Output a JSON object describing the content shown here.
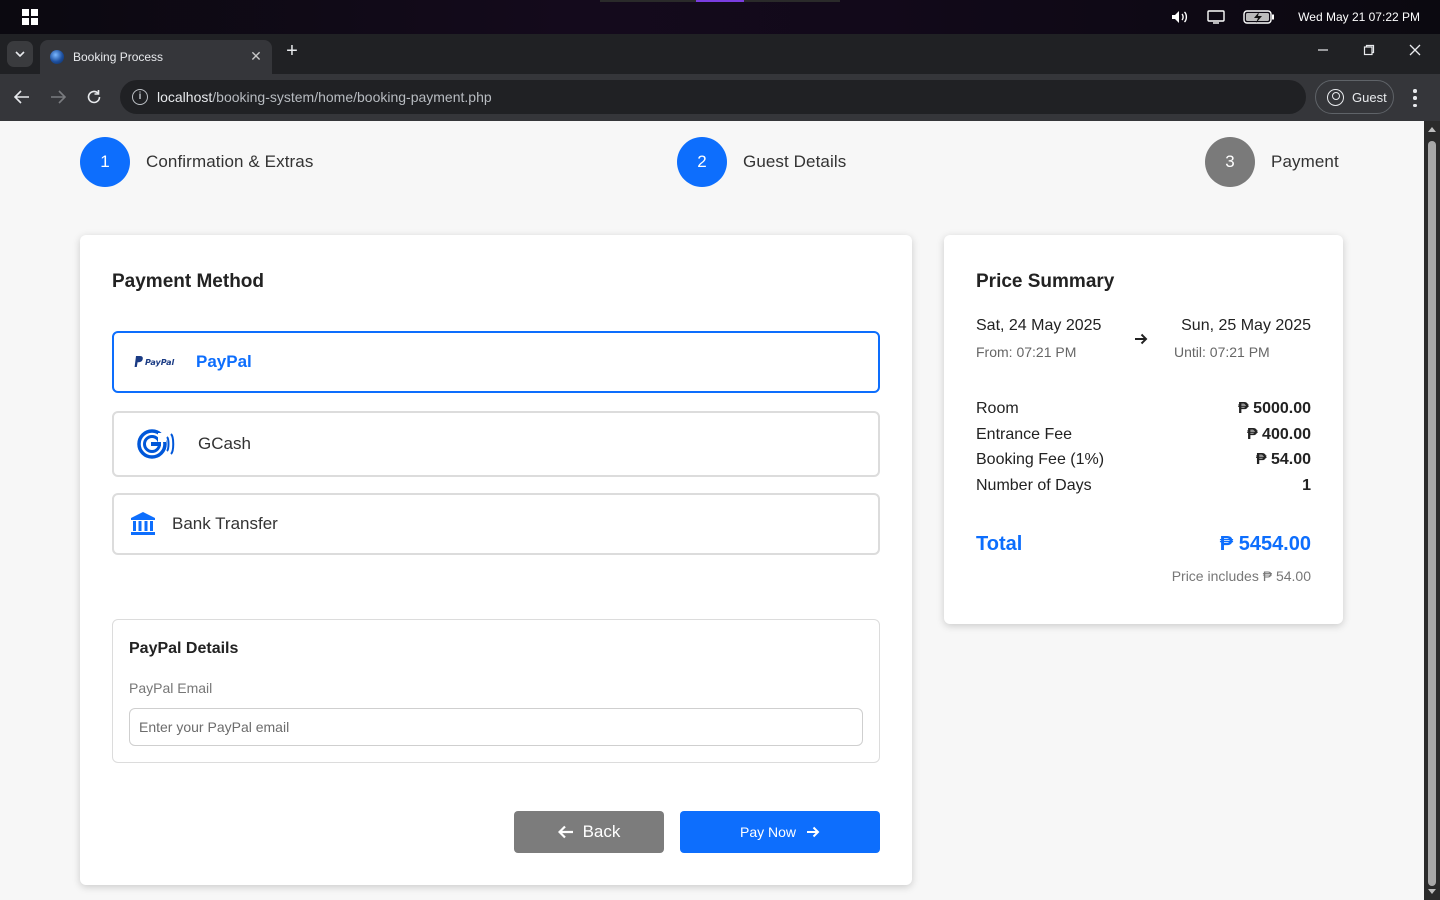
{
  "os": {
    "datetime": "Wed May 21  07:22 PM"
  },
  "browser": {
    "tab_title": "Booking Process",
    "url_host": "localhost",
    "url_path": "/booking-system/home/booking-payment.php",
    "profile_label": "Guest"
  },
  "steps": [
    {
      "number": "1",
      "label": "Confirmation & Extras",
      "state": "active"
    },
    {
      "number": "2",
      "label": "Guest Details",
      "state": "active"
    },
    {
      "number": "3",
      "label": "Payment",
      "state": "inactive"
    }
  ],
  "payment": {
    "title": "Payment Method",
    "methods": [
      {
        "label": "PayPal",
        "icon": "paypal-logo",
        "logo_text": "PayPal",
        "selected": true
      },
      {
        "label": "GCash",
        "icon": "gcash-logo",
        "selected": false
      },
      {
        "label": "Bank Transfer",
        "icon": "bank-icon",
        "selected": false
      }
    ],
    "details": {
      "title": "PayPal Details",
      "field_label": "PayPal Email",
      "field_value": "",
      "field_placeholder": "Enter your PayPal email"
    },
    "back_label": "Back",
    "pay_label": "Pay Now"
  },
  "summary": {
    "title": "Price Summary",
    "checkin_date": "Sat, 24 May 2025",
    "checkin_time": "From: 07:21 PM",
    "checkout_date": "Sun, 25 May 2025",
    "checkout_time": "Until: 07:21 PM",
    "lines": [
      {
        "label": "Room",
        "value": "₱ 5000.00"
      },
      {
        "label": "Entrance Fee",
        "value": "₱ 400.00"
      },
      {
        "label": "Booking Fee (1%)",
        "value": "₱ 54.00"
      },
      {
        "label": "Number of Days",
        "value": "1"
      }
    ],
    "total_label": "Total",
    "total_value": "₱ 5454.00",
    "note": "Price includes ₱ 54.00"
  },
  "colors": {
    "accent": "#0d6efd",
    "inactive": "#7a7a7a",
    "back_button": "#7c7c7c"
  }
}
